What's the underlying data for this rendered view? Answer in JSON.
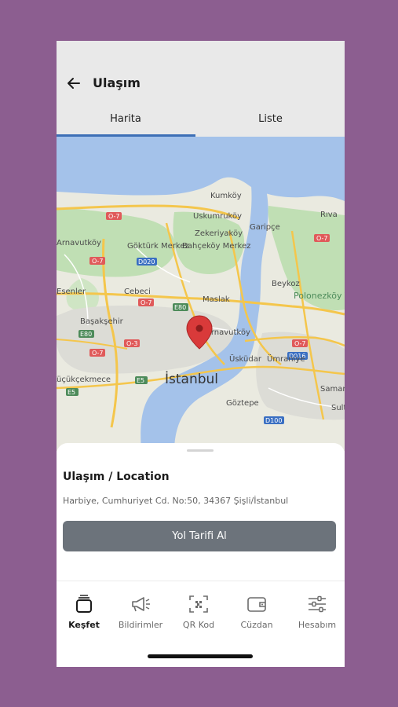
{
  "header": {
    "title": "Ulaşım",
    "tabs": [
      {
        "label": "Harita",
        "active": true
      },
      {
        "label": "Liste",
        "active": false
      }
    ]
  },
  "map": {
    "places": [
      "Kumköy",
      "Uskumruköy",
      "Garipçe",
      "Rıva",
      "Zekeriyaköy",
      "Göktürk Merkez",
      "Bahçeköy Merkez",
      "Arnavutköy",
      "Cebeci",
      "Maslak",
      "Beykoz",
      "Polonezköy Tabiat Parkı",
      "Başakşehir",
      "İstanbul",
      "Üsküdar",
      "Ümraniye",
      "Küçükçekmece",
      "Göztepe",
      "Samandıra",
      "Sultanbeyli",
      "Arnavutköy",
      "Esenler"
    ],
    "road_signs": [
      "O-7",
      "O-7",
      "O-7",
      "O-7",
      "O-7",
      "O-7",
      "O-3",
      "E80",
      "E80",
      "E5",
      "E5",
      "D020",
      "D016",
      "D100"
    ],
    "marker": "location-pin",
    "colors": {
      "water": "#a4c2ea",
      "land": "#eaeae0",
      "forest": "#c0dfb4",
      "road": "#f4c64c",
      "pin": "#d93a3a"
    }
  },
  "sheet": {
    "title": "Ulaşım / Location",
    "address": "Harbiye, Cumhuriyet Cd. No:50, 34367 Şişli/İstanbul",
    "button_label": "Yol Tarifi Al"
  },
  "nav": [
    {
      "label": "Keşfet",
      "icon": "discover-icon",
      "active": true
    },
    {
      "label": "Bildirimler",
      "icon": "megaphone-icon",
      "active": false
    },
    {
      "label": "QR Kod",
      "icon": "qr-code-icon",
      "active": false
    },
    {
      "label": "Cüzdan",
      "icon": "wallet-icon",
      "active": false
    },
    {
      "label": "Hesabım",
      "icon": "settings-sliders-icon",
      "active": false
    }
  ],
  "colors": {
    "page_bg": "#8c5e90",
    "accent": "#3d6fb6",
    "button": "#6c737b"
  }
}
